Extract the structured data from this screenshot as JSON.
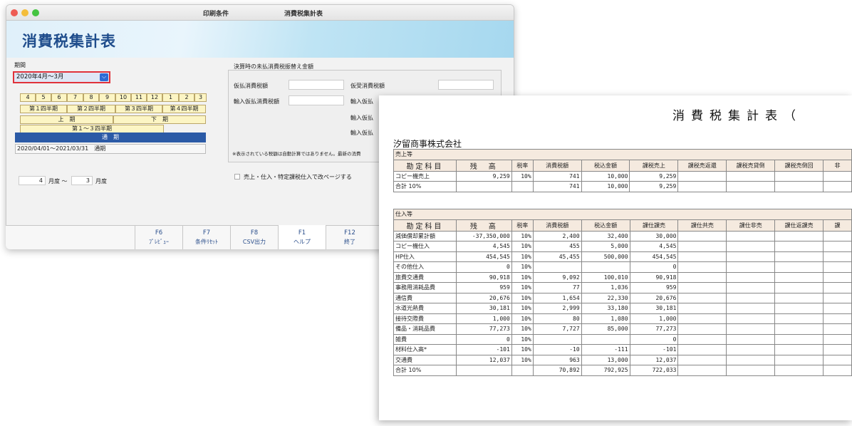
{
  "window": {
    "tabs": [
      "印刷条件",
      "消費税集計表"
    ],
    "banner_title": "消費税集計表"
  },
  "period": {
    "label": "期間",
    "selected": "2020年4月～3月",
    "months": [
      "4",
      "5",
      "6",
      "7",
      "8",
      "9",
      "10",
      "11",
      "12",
      "1",
      "2",
      "3"
    ],
    "quarters": [
      "第１四半期",
      "第２四半期",
      "第３四半期",
      "第４四半期"
    ],
    "halves": [
      "上　期",
      "下　期"
    ],
    "q1to3": "第１～３四半期",
    "full_year": "通　期",
    "date_range": "2020/04/01～2021/03/31　通期",
    "from_month": "4",
    "from_unit": "月度 ～",
    "to_month": "3",
    "to_unit": "月度"
  },
  "settlement": {
    "label": "決算時の未払消費税振替え金額",
    "karibarai": "仮払消費税額",
    "karijuke": "仮受消費税額",
    "yunyu_karibarai": "輸入仮払消費税額",
    "yunyu1": "輸入仮払",
    "yunyu2": "輸入仮払",
    "yunyu3": "輸入仮払",
    "note": "※表示されている税額は自動計算ではありません。最新の消費",
    "checkbox_label": "売上・仕入・特定課税仕入で改ページする"
  },
  "fkeys": [
    {
      "key": "F6",
      "label": "ﾌﾟﾚﾋﾞｭｰ"
    },
    {
      "key": "F7",
      "label": "条件ﾘｾｯﾄ"
    },
    {
      "key": "F8",
      "label": "CSV出力"
    },
    {
      "key": "F1",
      "label": "ヘルプ"
    },
    {
      "key": "F12",
      "label": "終了"
    }
  ],
  "report": {
    "title": "消費税集計表（",
    "company": "汐留商事株式会社",
    "sales_group": "売上等",
    "sales_headers": [
      "勘定科目",
      "残　高",
      "税率",
      "消費税額",
      "税込金額",
      "課税売上",
      "課税売返還",
      "課税売貸倒",
      "課税売倒回",
      "非"
    ],
    "sales_rows": [
      [
        "コピー機売上",
        "9,259",
        "10%",
        "741",
        "10,000",
        "9,259"
      ],
      [
        "合計 10%",
        "",
        "",
        "741",
        "10,000",
        "9,259"
      ]
    ],
    "purchase_group": "仕入等",
    "purchase_headers": [
      "勘定科目",
      "残　高",
      "税率",
      "消費税額",
      "税込金額",
      "課仕課売",
      "課仕共売",
      "課仕非売",
      "課仕返課売",
      "課"
    ],
    "purchase_rows": [
      [
        "減価償却累計額",
        "-37,350,000",
        "10%",
        "2,400",
        "32,400",
        "30,000"
      ],
      [
        "コピー機仕入",
        "4,545",
        "10%",
        "455",
        "5,000",
        "4,545"
      ],
      [
        "HP仕入",
        "454,545",
        "10%",
        "45,455",
        "500,000",
        "454,545"
      ],
      [
        "その他仕入",
        "0",
        "10%",
        "",
        "",
        "0"
      ],
      [
        "旅費交通費",
        "90,918",
        "10%",
        "9,092",
        "100,010",
        "90,918"
      ],
      [
        "事務用消耗品費",
        "959",
        "10%",
        "77",
        "1,036",
        "959"
      ],
      [
        "通信費",
        "20,676",
        "10%",
        "1,654",
        "22,330",
        "20,676"
      ],
      [
        "水道光熱費",
        "30,181",
        "10%",
        "2,999",
        "33,180",
        "30,181"
      ],
      [
        "接待交際費",
        "1,000",
        "10%",
        "80",
        "1,080",
        "1,000"
      ],
      [
        "備品・消耗品費",
        "77,273",
        "10%",
        "7,727",
        "85,000",
        "77,273"
      ],
      [
        "雑費",
        "0",
        "10%",
        "",
        "",
        "0"
      ],
      [
        "材料仕入高*",
        "-101",
        "10%",
        "-10",
        "-111",
        "-101"
      ],
      [
        "交通費",
        "12,037",
        "10%",
        "963",
        "13,000",
        "12,037"
      ],
      [
        "合計 10%",
        "",
        "",
        "70,892",
        "792,925",
        "722,033"
      ]
    ]
  }
}
